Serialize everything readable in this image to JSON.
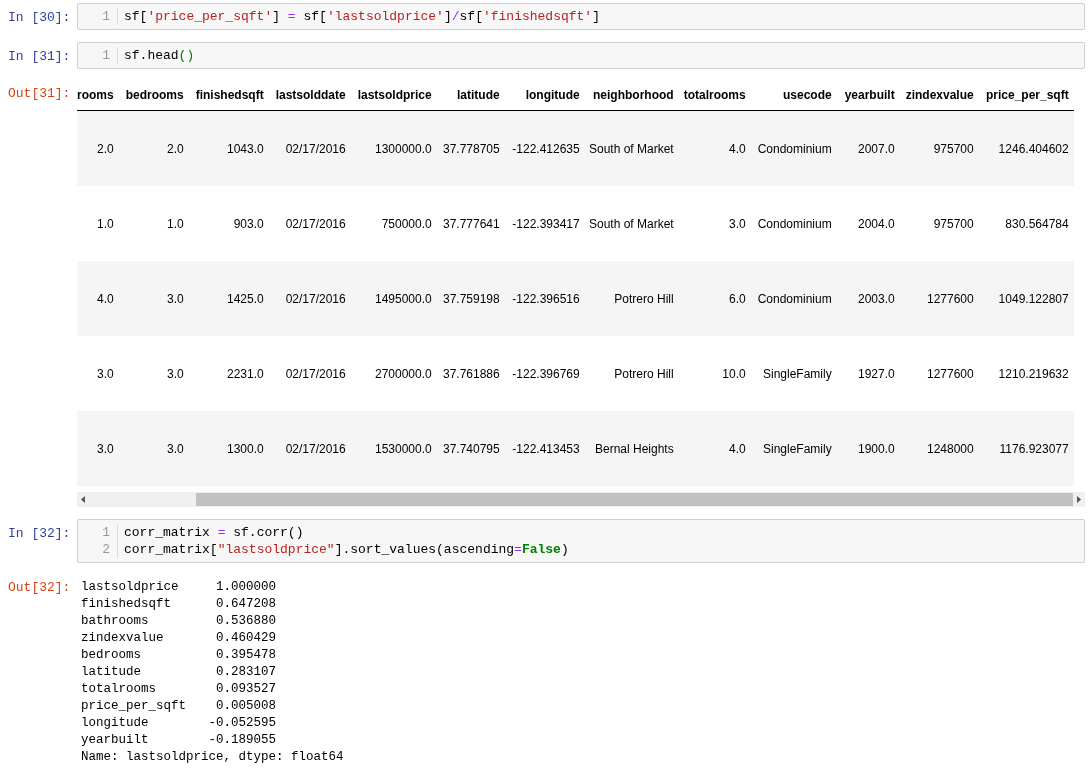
{
  "cells": [
    {
      "prompt": "In [30]:",
      "lines": [
        {
          "number": "1",
          "tokens": [
            {
              "kind": "plain",
              "text": "sf["
            },
            {
              "kind": "string",
              "text": "'price_per_sqft'"
            },
            {
              "kind": "plain",
              "text": "] "
            },
            {
              "kind": "operator",
              "text": "="
            },
            {
              "kind": "plain",
              "text": " sf["
            },
            {
              "kind": "string",
              "text": "'lastsoldprice'"
            },
            {
              "kind": "plain",
              "text": "]"
            },
            {
              "kind": "operator",
              "text": "/"
            },
            {
              "kind": "plain",
              "text": "sf["
            },
            {
              "kind": "string",
              "text": "'finishedsqft'"
            },
            {
              "kind": "plain",
              "text": "]"
            }
          ]
        }
      ]
    },
    {
      "prompt": "In [31]:",
      "lines": [
        {
          "number": "1",
          "tokens": [
            {
              "kind": "plain",
              "text": "sf.head"
            },
            {
              "kind": "matched",
              "text": "()"
            }
          ]
        }
      ],
      "output": {
        "prompt": "Out[31]:",
        "kind": "table",
        "columns": [
          "rooms",
          "bedrooms",
          "finishedsqft",
          "lastsolddate",
          "lastsoldprice",
          "latitude",
          "longitude",
          "neighborhood",
          "totalrooms",
          "usecode",
          "yearbuilt",
          "zindexvalue",
          "price_per_sqft"
        ],
        "rows": [
          [
            "2.0",
            "2.0",
            "1043.0",
            "02/17/2016",
            "1300000.0",
            "37.778705",
            "-122.412635",
            "South of Market",
            "4.0",
            "Condominium",
            "2007.0",
            "975700",
            "1246.404602"
          ],
          [
            "1.0",
            "1.0",
            "903.0",
            "02/17/2016",
            "750000.0",
            "37.777641",
            "-122.393417",
            "South of Market",
            "3.0",
            "Condominium",
            "2004.0",
            "975700",
            "830.564784"
          ],
          [
            "4.0",
            "3.0",
            "1425.0",
            "02/17/2016",
            "1495000.0",
            "37.759198",
            "-122.396516",
            "Potrero Hill",
            "6.0",
            "Condominium",
            "2003.0",
            "1277600",
            "1049.122807"
          ],
          [
            "3.0",
            "3.0",
            "2231.0",
            "02/17/2016",
            "2700000.0",
            "37.761886",
            "-122.396769",
            "Potrero Hill",
            "10.0",
            "SingleFamily",
            "1927.0",
            "1277600",
            "1210.219632"
          ],
          [
            "3.0",
            "3.0",
            "1300.0",
            "02/17/2016",
            "1530000.0",
            "37.740795",
            "-122.413453",
            "Bernal Heights",
            "4.0",
            "SingleFamily",
            "1900.0",
            "1248000",
            "1176.923077"
          ]
        ]
      }
    },
    {
      "prompt": "In [32]:",
      "lines": [
        {
          "number": "1",
          "tokens": [
            {
              "kind": "plain",
              "text": "corr_matrix "
            },
            {
              "kind": "operator",
              "text": "="
            },
            {
              "kind": "plain",
              "text": " sf.corr()"
            }
          ]
        },
        {
          "number": "2",
          "tokens": [
            {
              "kind": "plain",
              "text": "corr_matrix["
            },
            {
              "kind": "string",
              "text": "\"lastsoldprice\""
            },
            {
              "kind": "plain",
              "text": "].sort_values(ascending"
            },
            {
              "kind": "operator",
              "text": "="
            },
            {
              "kind": "keyword",
              "text": "False"
            },
            {
              "kind": "plain",
              "text": ")"
            }
          ]
        }
      ],
      "output": {
        "prompt": "Out[32]:",
        "kind": "text",
        "lines": [
          "lastsoldprice     1.000000",
          "finishedsqft      0.647208",
          "bathrooms         0.536880",
          "zindexvalue       0.460429",
          "bedrooms          0.395478",
          "latitude          0.283107",
          "totalrooms        0.093527",
          "price_per_sqft    0.005008",
          "longitude        -0.052595",
          "yearbuilt        -0.189055",
          "Name: lastsoldprice, dtype: float64"
        ]
      }
    }
  ]
}
